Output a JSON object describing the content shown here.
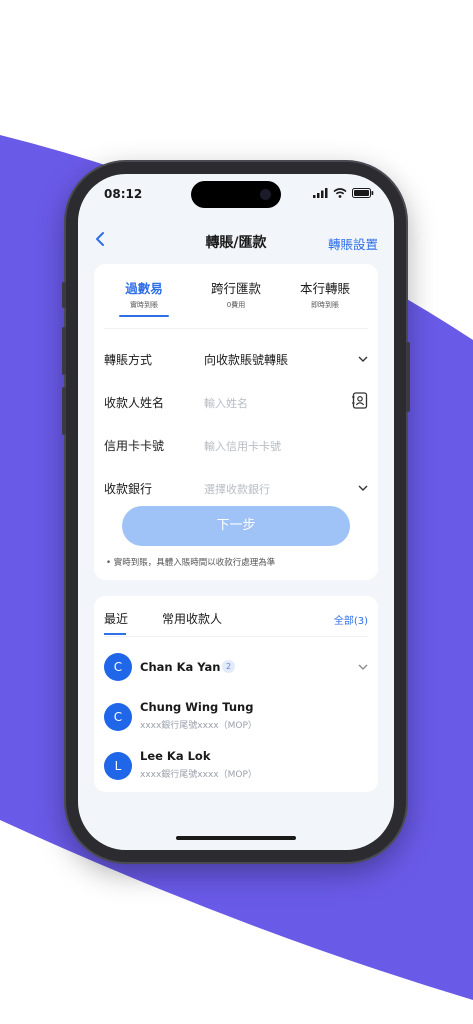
{
  "colors": {
    "accent": "#2f6fe8",
    "purple": "#6a5ae8",
    "button_disabled": "#9fc3f6",
    "avatar": "#1f66e8"
  },
  "status_bar": {
    "time": "08:12",
    "icons": [
      "signal-icon",
      "wifi-icon",
      "battery-icon"
    ]
  },
  "header": {
    "back_icon": "chevron-left-icon",
    "title": "轉賬/匯款",
    "settings_label": "轉賬設置"
  },
  "transfer_tabs": [
    {
      "label": "過數易",
      "sub": "實時到賬",
      "active": true
    },
    {
      "label": "跨行匯款",
      "sub": "0費用",
      "active": false
    },
    {
      "label": "本行轉賬",
      "sub": "即時到賬",
      "active": false
    }
  ],
  "form": {
    "method": {
      "label": "轉賬方式",
      "value": "向收款賬號轉賬"
    },
    "payee_name": {
      "label": "收款人姓名",
      "placeholder": "輸入姓名"
    },
    "card_number": {
      "label": "信用卡卡號",
      "placeholder": "輸入信用卡卡號"
    },
    "bank": {
      "label": "收款銀行",
      "placeholder": "選擇收款銀行"
    },
    "next_label": "下一步",
    "note": "實時到賬，具體入賬時間以收款行處理為準"
  },
  "recent": {
    "tabs": [
      "最近",
      "常用收款人"
    ],
    "all_label": "全部(3)",
    "payees": [
      {
        "initial": "C",
        "name": "Chan Ka Yan",
        "badge": "2",
        "sub": ""
      },
      {
        "initial": "C",
        "name": "Chung Wing Tung",
        "sub": "xxxx銀行尾號xxxx（MOP）"
      },
      {
        "initial": "L",
        "name": "Lee Ka Lok",
        "sub": "xxxx銀行尾號xxxx（MOP）"
      }
    ]
  }
}
